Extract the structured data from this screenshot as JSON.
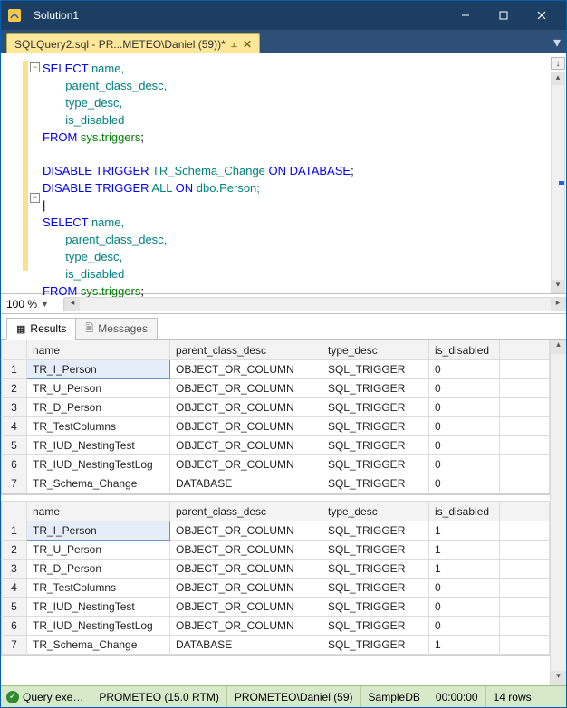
{
  "window": {
    "title": "Solution1"
  },
  "tab": {
    "label": "SQLQuery2.sql - PR...METEO\\Daniel (59))*",
    "dirty": "*"
  },
  "editor": {
    "line1_kw": "SELECT",
    "line1_rest": " name,",
    "line2": "       parent_class_desc,",
    "line3": "       type_desc,",
    "line4": "       is_disabled",
    "line5_kw": "FROM",
    "line5_fn": " sys.triggers",
    "line5_end": ";",
    "line7a_kw": "DISABLE TRIGGER",
    "line7a_mid": " TR_Schema_Change ",
    "line7a_kw2": "ON DATABASE",
    "line7a_end": ";",
    "line7b_kw": "DISABLE TRIGGER",
    "line7b_mid": " ALL ",
    "line7b_kw2": "ON",
    "line7b_rest": " dbo.Person;",
    "cursor": "|",
    "line9_kw": "SELECT",
    "line9_rest": " name,",
    "line10": "       parent_class_desc,",
    "line11": "       type_desc,",
    "line12": "       is_disabled",
    "line13_kw": "FROM",
    "line13_fn": " sys.triggers",
    "line13_end": ";"
  },
  "zoom": {
    "level": "100 %"
  },
  "results_tabs": {
    "results": "Results",
    "messages": "Messages"
  },
  "grid": {
    "columns": {
      "c0": "",
      "c1": "name",
      "c2": "parent_class_desc",
      "c3": "type_desc",
      "c4": "is_disabled"
    },
    "g1": {
      "rows": [
        {
          "n": "1",
          "name": "TR_I_Person",
          "pcd": "OBJECT_OR_COLUMN",
          "td": "SQL_TRIGGER",
          "dis": "0"
        },
        {
          "n": "2",
          "name": "TR_U_Person",
          "pcd": "OBJECT_OR_COLUMN",
          "td": "SQL_TRIGGER",
          "dis": "0"
        },
        {
          "n": "3",
          "name": "TR_D_Person",
          "pcd": "OBJECT_OR_COLUMN",
          "td": "SQL_TRIGGER",
          "dis": "0"
        },
        {
          "n": "4",
          "name": "TR_TestColumns",
          "pcd": "OBJECT_OR_COLUMN",
          "td": "SQL_TRIGGER",
          "dis": "0"
        },
        {
          "n": "5",
          "name": "TR_IUD_NestingTest",
          "pcd": "OBJECT_OR_COLUMN",
          "td": "SQL_TRIGGER",
          "dis": "0"
        },
        {
          "n": "6",
          "name": "TR_IUD_NestingTestLog",
          "pcd": "OBJECT_OR_COLUMN",
          "td": "SQL_TRIGGER",
          "dis": "0"
        },
        {
          "n": "7",
          "name": "TR_Schema_Change",
          "pcd": "DATABASE",
          "td": "SQL_TRIGGER",
          "dis": "0"
        }
      ]
    },
    "g2": {
      "rows": [
        {
          "n": "1",
          "name": "TR_I_Person",
          "pcd": "OBJECT_OR_COLUMN",
          "td": "SQL_TRIGGER",
          "dis": "1"
        },
        {
          "n": "2",
          "name": "TR_U_Person",
          "pcd": "OBJECT_OR_COLUMN",
          "td": "SQL_TRIGGER",
          "dis": "1"
        },
        {
          "n": "3",
          "name": "TR_D_Person",
          "pcd": "OBJECT_OR_COLUMN",
          "td": "SQL_TRIGGER",
          "dis": "1"
        },
        {
          "n": "4",
          "name": "TR_TestColumns",
          "pcd": "OBJECT_OR_COLUMN",
          "td": "SQL_TRIGGER",
          "dis": "0"
        },
        {
          "n": "5",
          "name": "TR_IUD_NestingTest",
          "pcd": "OBJECT_OR_COLUMN",
          "td": "SQL_TRIGGER",
          "dis": "0"
        },
        {
          "n": "6",
          "name": "TR_IUD_NestingTestLog",
          "pcd": "OBJECT_OR_COLUMN",
          "td": "SQL_TRIGGER",
          "dis": "0"
        },
        {
          "n": "7",
          "name": "TR_Schema_Change",
          "pcd": "DATABASE",
          "td": "SQL_TRIGGER",
          "dis": "1"
        }
      ]
    }
  },
  "status": {
    "query": "Query exe…",
    "server": "PROMETEO (15.0 RTM)",
    "user": "PROMETEO\\Daniel (59)",
    "db": "SampleDB",
    "time": "00:00:00",
    "rows": "14 rows"
  }
}
